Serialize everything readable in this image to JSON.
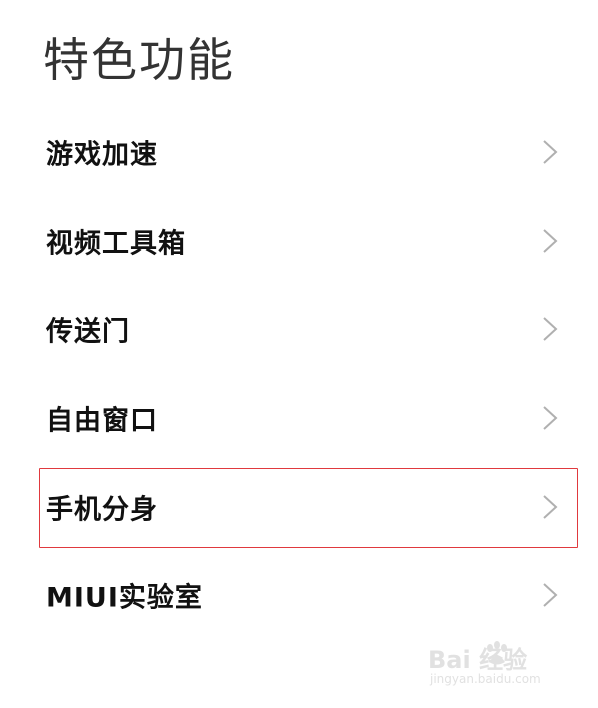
{
  "header": {
    "title": "特色功能"
  },
  "settings_list": {
    "items": [
      {
        "label": "游戏加速"
      },
      {
        "label": "视频工具箱"
      },
      {
        "label": "传送门"
      },
      {
        "label": "自由窗口"
      },
      {
        "label": "手机分身"
      },
      {
        "label": "MIUI实验室"
      }
    ]
  },
  "highlight": {
    "color": "#e0393e"
  },
  "watermark": {
    "logo_text": "Bai  经验",
    "url": "jingyan.baidu.com"
  },
  "icons": {
    "row_chevron": "chevron-right-icon"
  }
}
